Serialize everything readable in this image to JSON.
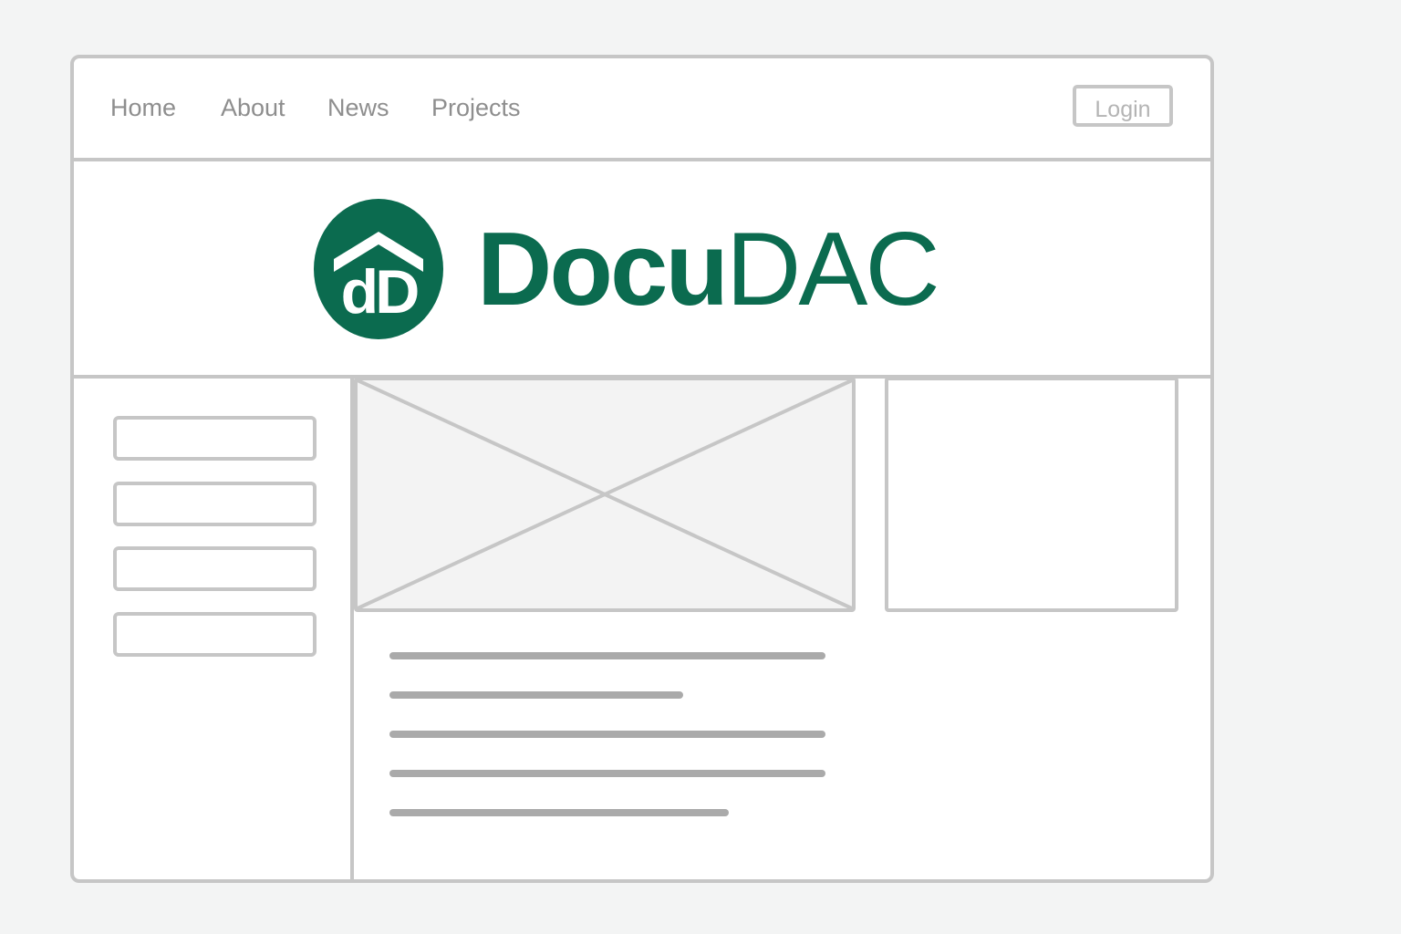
{
  "nav": {
    "links": [
      {
        "label": "Home"
      },
      {
        "label": "About"
      },
      {
        "label": "News"
      },
      {
        "label": "Projects"
      }
    ],
    "login_label": "Login"
  },
  "brand": {
    "logo_letters": "dD",
    "name_part_1": "Docu",
    "name_part_2": "DAC",
    "color": "#0b6b4f"
  },
  "colors": {
    "wireframe_border": "#c6c6c6",
    "nav_text": "#8e8e8e",
    "text_line": "#aaaaaa"
  },
  "icons": {
    "logo": "house-roof-emblem",
    "image_placeholder": "crossed-box-image-placeholder"
  }
}
